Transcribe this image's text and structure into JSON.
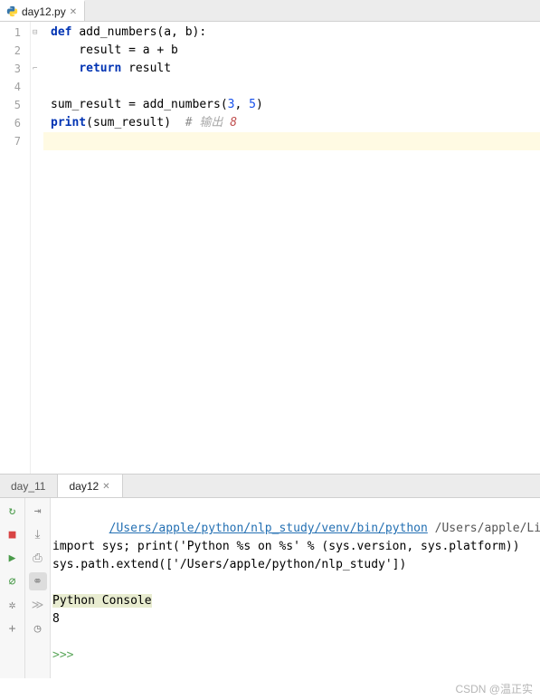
{
  "editor": {
    "tab": {
      "label": "day12.py"
    },
    "lines": [
      {
        "n": "1",
        "indent": 0,
        "tokens": [
          [
            "kw",
            "def "
          ],
          [
            "fn",
            "add_numbers"
          ],
          [
            "",
            "(a, b):"
          ]
        ]
      },
      {
        "n": "2",
        "indent": 1,
        "tokens": [
          [
            "",
            "result = a + b"
          ]
        ]
      },
      {
        "n": "3",
        "indent": 1,
        "tokens": [
          [
            "kw",
            "return "
          ],
          [
            "",
            "result"
          ]
        ]
      },
      {
        "n": "4",
        "indent": 0,
        "tokens": []
      },
      {
        "n": "5",
        "indent": 0,
        "tokens": [
          [
            "",
            "sum_result = add_numbers("
          ],
          [
            "num",
            "3"
          ],
          [
            "",
            ", "
          ],
          [
            "num",
            "5"
          ],
          [
            "",
            ")"
          ]
        ]
      },
      {
        "n": "6",
        "indent": 0,
        "tokens": [
          [
            "kw",
            "print"
          ],
          [
            "",
            "(sum_result)  "
          ],
          [
            "cmt",
            "# "
          ],
          [
            "cmt-cn",
            "输出 "
          ],
          [
            "cmt-out",
            "8"
          ]
        ]
      },
      {
        "n": "7",
        "indent": 0,
        "tokens": [],
        "current": true
      }
    ],
    "folds": [
      {
        "row": 0,
        "glyph": "⊟"
      },
      {
        "row": 2,
        "glyph": "⌐"
      }
    ]
  },
  "console": {
    "tabs": [
      {
        "label": "day_11",
        "active": false
      },
      {
        "label": "day12",
        "active": true
      }
    ],
    "toolbar_left": [
      {
        "name": "rerun-icon",
        "glyph": "↻",
        "color": "#4a9b4a"
      },
      {
        "name": "stop-icon",
        "glyph": "■",
        "color": "#d84444"
      },
      {
        "name": "run-icon",
        "glyph": "▶",
        "color": "#4a9b4a"
      },
      {
        "name": "debug-icon",
        "glyph": "⌀",
        "color": "#4a9b4a"
      },
      {
        "name": "settings-icon",
        "glyph": "✲",
        "color": "#888"
      },
      {
        "name": "add-icon",
        "glyph": "+",
        "color": "#888"
      }
    ],
    "toolbar_left2": [
      {
        "name": "soft-wrap-icon",
        "glyph": "⇥",
        "color": "#888"
      },
      {
        "name": "scroll-end-icon",
        "glyph": "⤓",
        "color": "#888"
      },
      {
        "name": "print-icon",
        "glyph": "⎙",
        "color": "#888"
      },
      {
        "name": "link-icon",
        "glyph": "⚭",
        "color": "#888",
        "bg": "#ddd"
      },
      {
        "name": "prompt-icon",
        "glyph": "≫",
        "color": "#aaa"
      },
      {
        "name": "history-icon",
        "glyph": "◷",
        "color": "#888"
      }
    ],
    "output": {
      "interp_link": "/Users/apple/python/nlp_study/venv/bin/python",
      "interp_rest": " /Users/apple/Library/",
      "line2": "import sys; print('Python %s on %s' % (sys.version, sys.platform))",
      "line3": "sys.path.extend(['/Users/apple/python/nlp_study'])",
      "console_label": "Python Console",
      "result": "8",
      "prompt": ">>>"
    }
  },
  "watermark": "CSDN @温正实"
}
